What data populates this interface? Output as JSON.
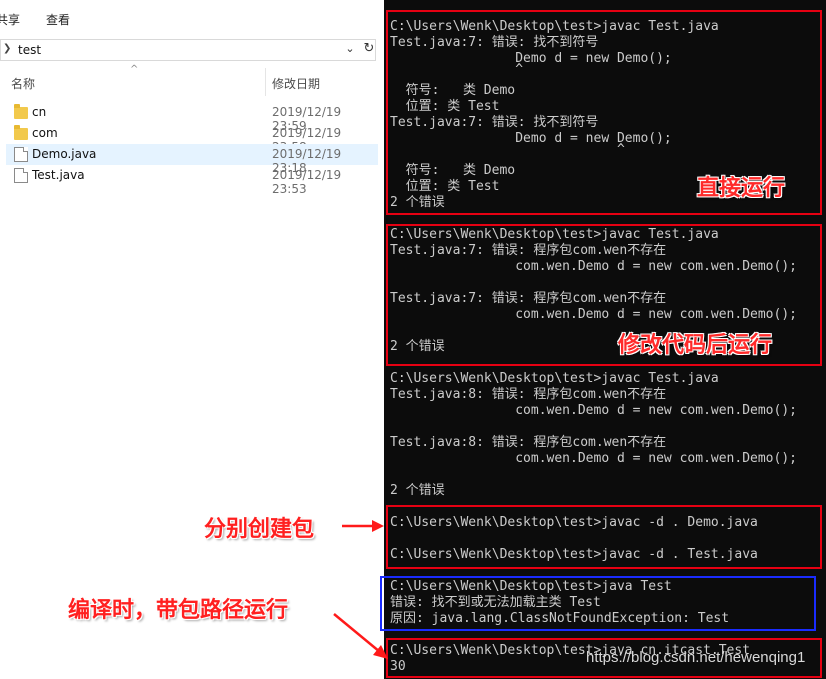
{
  "explorer": {
    "ribbon_tabs": [
      "共享",
      "查看"
    ],
    "address": {
      "path": "test"
    },
    "columns": {
      "name": "名称",
      "date": "修改日期"
    },
    "files": [
      {
        "name": "cn",
        "date": "2019/12/19 23:59",
        "type": "folder"
      },
      {
        "name": "com",
        "date": "2019/12/19 23:58",
        "type": "folder"
      },
      {
        "name": "Demo.java",
        "date": "2019/12/19 23:18",
        "type": "file",
        "selected": true
      },
      {
        "name": "Test.java",
        "date": "2019/12/19 23:53",
        "type": "file"
      }
    ]
  },
  "console": {
    "lines": [
      "C:\\Users\\Wenk\\Desktop\\test>javac Test.java",
      "Test.java:7: 错误: 找不到符号",
      "                Demo d = new Demo();",
      "                ^",
      "  符号:   类 Demo",
      "  位置: 类 Test",
      "Test.java:7: 错误: 找不到符号",
      "                Demo d = new Demo();",
      "                             ^",
      "  符号:   类 Demo",
      "  位置: 类 Test",
      "2 个错误",
      "C:\\Users\\Wenk\\Desktop\\test>javac Test.java",
      "Test.java:7: 错误: 程序包com.wen不存在",
      "                com.wen.Demo d = new com.wen.Demo();",
      "Test.java:7: 错误: 程序包com.wen不存在",
      "                com.wen.Demo d = new com.wen.Demo();",
      "2 个错误",
      "C:\\Users\\Wenk\\Desktop\\test>javac Test.java",
      "Test.java:8: 错误: 程序包com.wen不存在",
      "                com.wen.Demo d = new com.wen.Demo();",
      "Test.java:8: 错误: 程序包com.wen不存在",
      "                com.wen.Demo d = new com.wen.Demo();",
      "2 个错误",
      "C:\\Users\\Wenk\\Desktop\\test>javac -d . Demo.java",
      "C:\\Users\\Wenk\\Desktop\\test>javac -d . Test.java",
      "C:\\Users\\Wenk\\Desktop\\test>java Test",
      "错误: 找不到或无法加载主类 Test",
      "原因: java.lang.ClassNotFoundException: Test",
      "C:\\Users\\Wenk\\Desktop\\test>java cn.itcast.Test",
      "30"
    ]
  },
  "annotations": {
    "direct_run": "直接运行",
    "run_after_edit": "修改代码后运行",
    "create_packages": "分别创建包",
    "compile_with_path": "编译时，带包路径运行"
  },
  "watermark": "https://blog.csdn.net/hewenqing1",
  "colors": {
    "highlight_red": "#e60012",
    "highlight_blue": "#1a2cff",
    "console_bg": "#0c0c0c",
    "selection": "#e5f3ff"
  }
}
